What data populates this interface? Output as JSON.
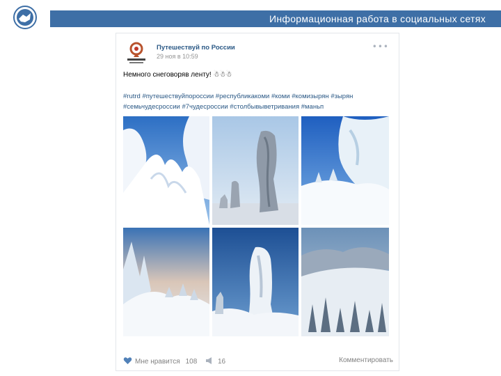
{
  "slide": {
    "title": "Информационная работа в социальных сетях"
  },
  "post": {
    "author": "Путешествуй по России",
    "date": "29 ноя в 10:59",
    "text": "Немного снеговоряв ленту! ☃☃☃",
    "tags_line1": "#rutrd #путешествуйпороссии #республикакоми #коми #комизырян #зырян",
    "tags_line2": "#семьчудесроссии #7чудесроссии #столбывыветривания #маньп",
    "likes_label": "Мне нравится",
    "likes_count": "108",
    "reposts_count": "16",
    "comment_label": "Комментировать",
    "photos": [
      "snowy-forest",
      "weathering-pillars",
      "frosted-trees",
      "snowy-hillside-trees",
      "pillar-closeup",
      "snowy-mountain-forest"
    ]
  },
  "colors": {
    "banner": "#3e6fa6",
    "link": "#2a5885"
  },
  "icons": [
    "emblem-icon",
    "more-icon",
    "heart-icon",
    "repost-icon"
  ]
}
